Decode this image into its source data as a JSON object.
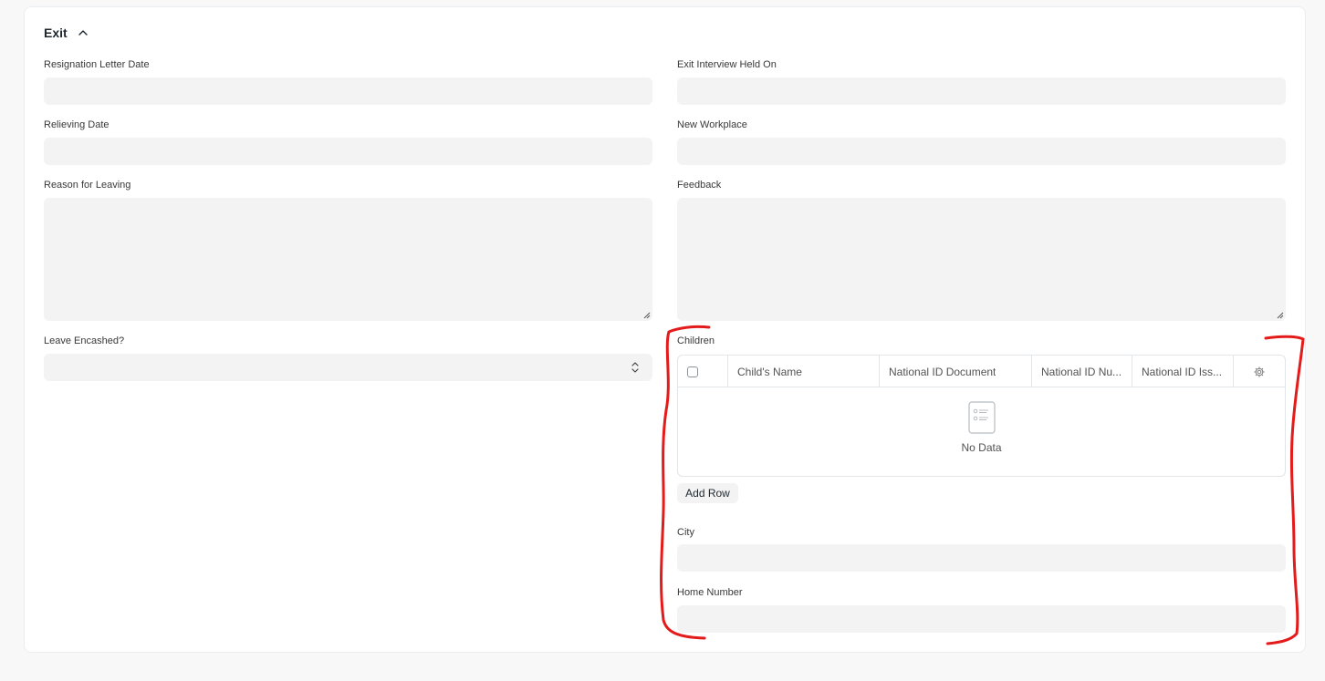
{
  "section": {
    "title": "Exit"
  },
  "left": {
    "resignation_label": "Resignation Letter Date",
    "relieving_label": "Relieving Date",
    "reason_label": "Reason for Leaving",
    "leave_encashed_label": "Leave Encashed?"
  },
  "right": {
    "exit_interview_label": "Exit Interview Held On",
    "new_workplace_label": "New Workplace",
    "feedback_label": "Feedback",
    "children_label": "Children",
    "city_label": "City",
    "home_number_label": "Home Number"
  },
  "children_table": {
    "columns": [
      "Child's Name",
      "National ID Document",
      "National ID Nu...",
      "National ID Iss..."
    ],
    "empty_text": "No Data",
    "add_row_label": "Add Row"
  },
  "icons": {
    "collapse": "chevron-up-icon",
    "settings": "gear-icon",
    "empty": "list-document-icon",
    "select": "updown-arrows-icon"
  },
  "colors": {
    "annotation": "#e31b1b",
    "input_bg": "#f3f3f4"
  }
}
